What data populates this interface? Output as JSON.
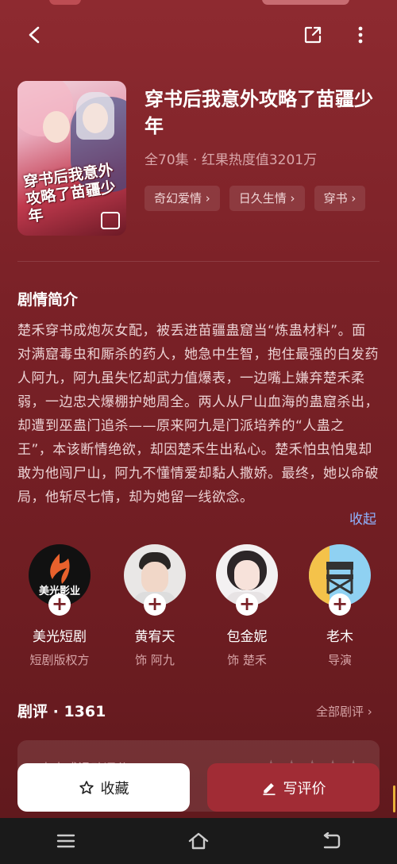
{
  "header": {
    "back_icon": "back-arrow-icon",
    "share_icon": "share-icon",
    "more_icon": "more-icon"
  },
  "show": {
    "cover_text": "穿书后我意外攻略了苗疆少年",
    "title": "穿书后我意外攻略了苗疆少年",
    "meta": "全70集 · 红果热度值3201万",
    "tags": [
      "奇幻爱情 ›",
      "日久生情 ›",
      "穿书 ›"
    ]
  },
  "synopsis": {
    "heading": "剧情简介",
    "text": "楚禾穿书成炮灰女配，被丢进苗疆蛊窟当“炼蛊材料”。面对满窟毒虫和厮杀的药人，她急中生智，抱住最强的白发药人阿九，阿九虽失忆却武力值爆表，一边嘴上嫌弃楚禾柔弱，一边忠犬爆棚护她周全。两人从尸山血海的蛊窟杀出，却遭到巫蛊门追杀——原来阿九是门派培养的“人蛊之王”，本该断情绝欲，却因楚禾生出私心。楚禾怕虫怕鬼却敢为他闯尸山，阿九不懂情爱却黏人撒娇。最终，她以命破局，他斩尽七情，却为她留一线欲念。",
    "collapse_label": "收起"
  },
  "cast": [
    {
      "name": "美光短剧",
      "role": "短剧版权方",
      "avatar_text": "美光影业"
    },
    {
      "name": "黄宥天",
      "role": "饰 阿九"
    },
    {
      "name": "包金妮",
      "role": "饰 楚禾"
    },
    {
      "name": "老木",
      "role": "导演"
    }
  ],
  "reviews": {
    "heading": "剧评 · 1361",
    "all_label": "全部剧评 ›",
    "placeholder": "点击或滑动评分"
  },
  "actions": {
    "favorite_label": "收藏",
    "review_label": "写评价"
  },
  "colors": {
    "accent": "#a12c35",
    "link": "#8fb3ff"
  }
}
